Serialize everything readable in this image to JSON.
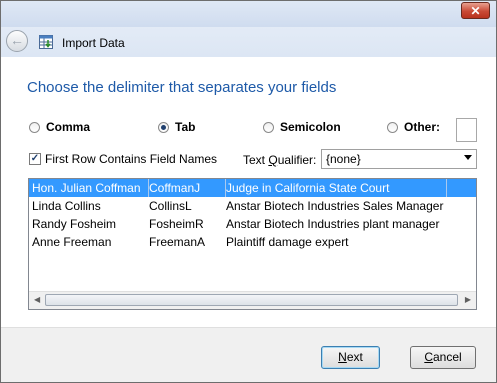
{
  "nav": {
    "title": "Import Data"
  },
  "main": {
    "heading": "Choose the delimiter that separates your fields",
    "delimiters": [
      {
        "label": "Comma",
        "checked": false
      },
      {
        "label": "Tab",
        "checked": true
      },
      {
        "label": "Semicolon",
        "checked": false
      },
      {
        "label": "Other:",
        "checked": false
      }
    ],
    "other_value": "",
    "first_row_checkbox": {
      "label": "First Row Contains Field Names",
      "checked": true
    },
    "text_qualifier": {
      "label": "Text Qualifier:",
      "value": "{none}"
    },
    "rows": [
      [
        "Hon. Julian Coffman",
        "CoffmanJ",
        "Judge in California State Court"
      ],
      [
        "Linda Collins",
        "CollinsL",
        "Anstar Biotech Industries Sales Manager"
      ],
      [
        "Randy Fosheim",
        "FosheimR",
        "Anstar Biotech Industries plant manager"
      ],
      [
        "Anne Freeman",
        "FreemanA",
        "Plaintiff damage expert"
      ]
    ],
    "selected_row": 0
  },
  "footer": {
    "next_label": "Next",
    "cancel_label": "Cancel"
  },
  "colors": {
    "heading": "#1e5aa8",
    "selection": "#3399ff"
  }
}
